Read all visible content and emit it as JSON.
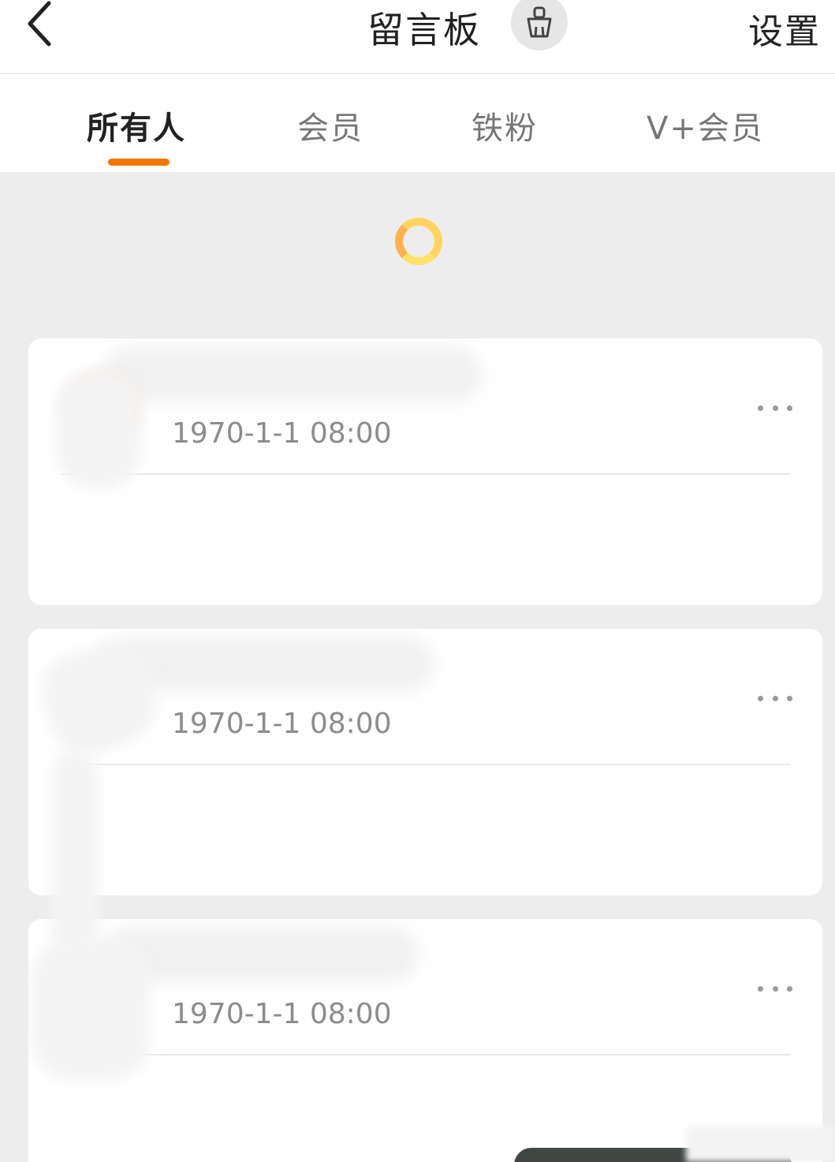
{
  "header": {
    "back_icon": "chevron-left-icon",
    "title": "留言板",
    "clean_icon": "broom-icon",
    "settings_label": "设置"
  },
  "tabs": [
    {
      "label": "所有人",
      "active": true
    },
    {
      "label": "会员",
      "active": false
    },
    {
      "label": "铁粉",
      "active": false
    },
    {
      "label": "V+会员",
      "active": false
    }
  ],
  "colors": {
    "accent": "#f07800",
    "background": "#ededed",
    "card": "#ffffff",
    "muted_text": "#8c8c8c"
  },
  "loading": {
    "icon": "loading-spinner-icon"
  },
  "messages": [
    {
      "time": "1970-1-1 08:00",
      "more_icon": "more-dots-icon"
    },
    {
      "time": "1970-1-1 08:00",
      "more_icon": "more-dots-icon"
    },
    {
      "time": "1970-1-1 08:00",
      "more_icon": "more-dots-icon"
    }
  ]
}
